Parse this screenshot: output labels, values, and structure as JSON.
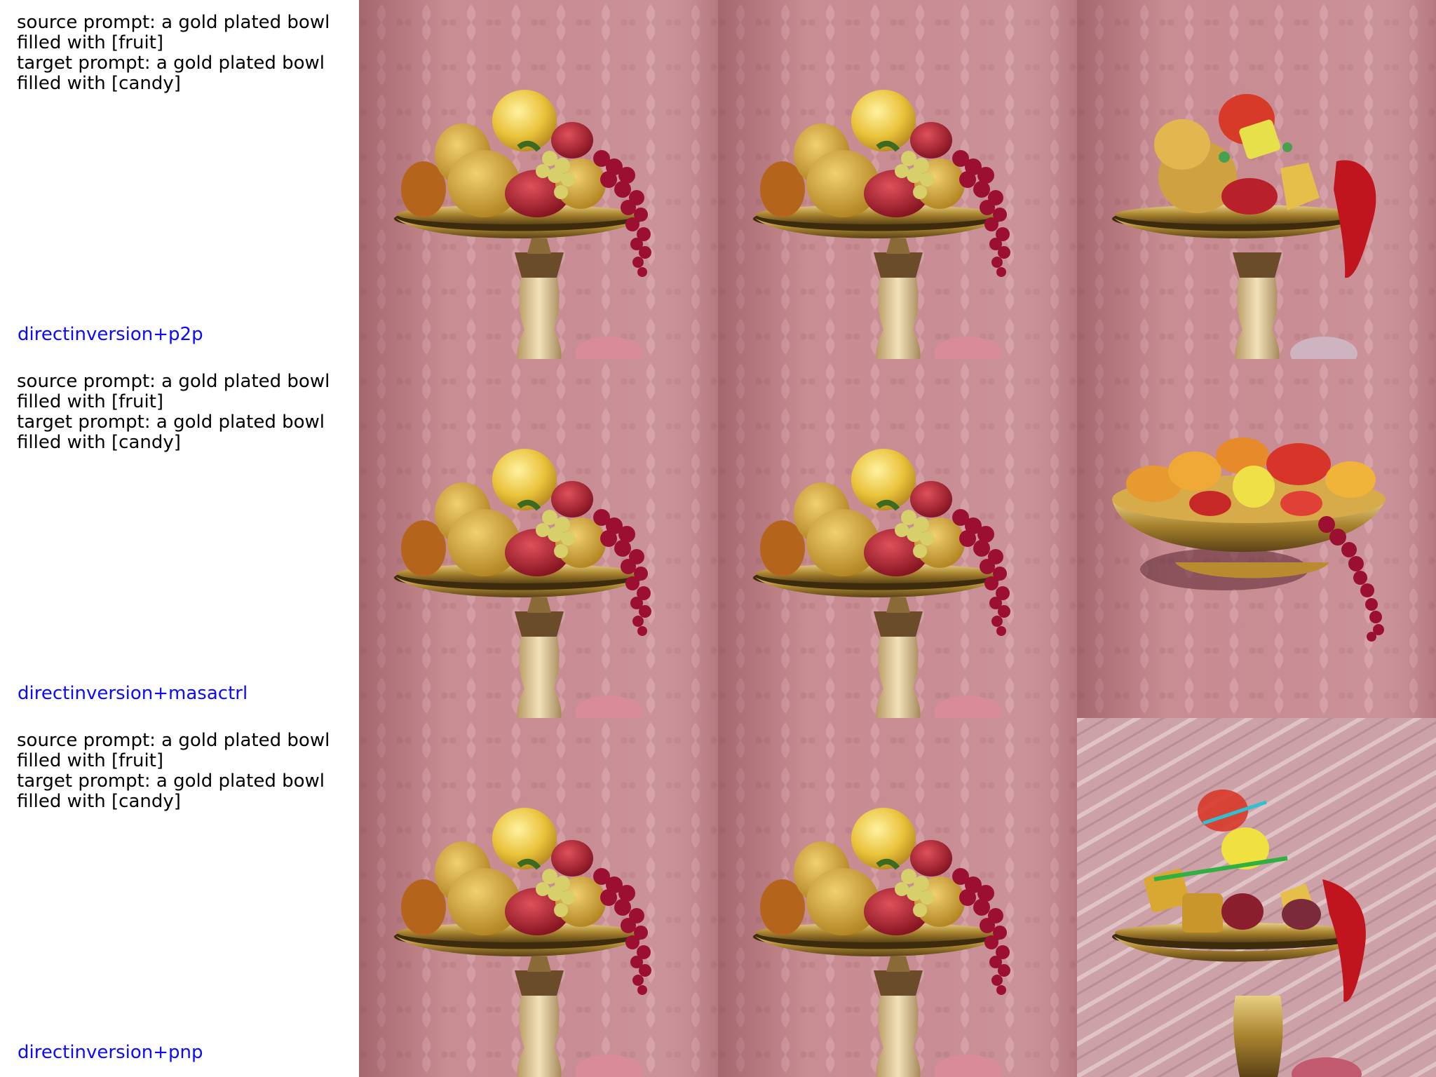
{
  "rows": [
    {
      "source_prompt": "source prompt: a gold plated bowl\nfilled with [fruit]",
      "target_prompt": "target prompt: a gold plated bowl\nfilled with [candy]",
      "method": "directinversion+p2p"
    },
    {
      "source_prompt": "source prompt: a gold plated bowl\nfilled with [fruit]",
      "target_prompt": "target prompt: a gold plated bowl\nfilled with [candy]",
      "method": "directinversion+masactrl"
    },
    {
      "source_prompt": "source prompt: a gold plated bowl\nfilled with [fruit]",
      "target_prompt": "target prompt: a gold plated bowl\nfilled with [candy]",
      "method": "directinversion+pnp"
    }
  ],
  "colors": {
    "method_label": "#0a0aff",
    "wallpaper": "#c98d94",
    "gold": "#c9a24a",
    "grape": "#9b1030",
    "apple_yellow": "#e8c43c"
  }
}
